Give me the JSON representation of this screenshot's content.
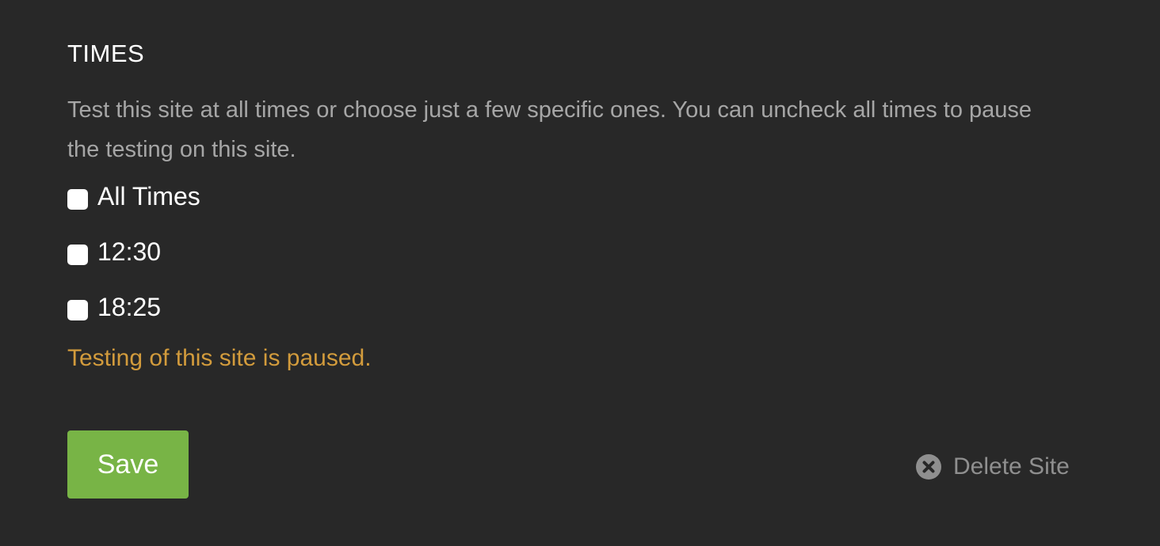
{
  "section": {
    "title": "TIMES",
    "description": "Test this site at all times or choose just a few specific ones. You can uncheck all times to pause the testing on this site."
  },
  "times": {
    "options": [
      {
        "label": "All Times",
        "checked": false
      },
      {
        "label": "12:30",
        "checked": false
      },
      {
        "label": "18:25",
        "checked": false
      }
    ]
  },
  "status": {
    "text": "Testing of this site is paused.",
    "color": "#d29b3c"
  },
  "actions": {
    "save_label": "Save",
    "delete_label": "Delete Site",
    "delete_icon": "close-circle-icon"
  },
  "colors": {
    "background": "#282828",
    "save_button": "#78b446",
    "delete_text": "#8f8f8f"
  }
}
